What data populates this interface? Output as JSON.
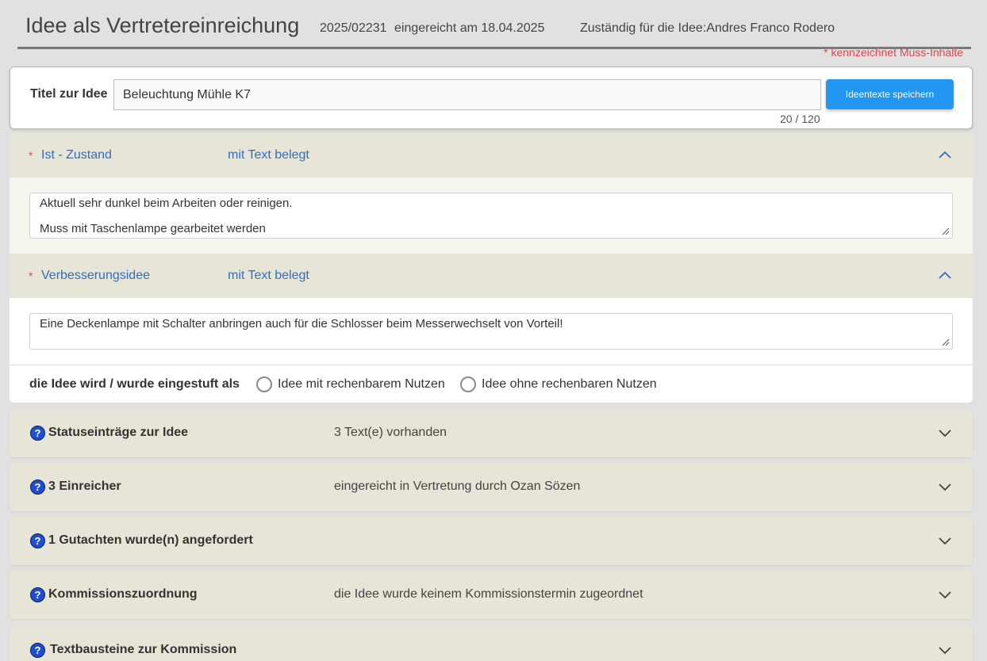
{
  "header": {
    "title": "Idee als Vertretereinreichung",
    "number": "2025/02231",
    "submitted": "eingereicht am 18.04.2025",
    "responsible_label": "Zuständig für die Idee:",
    "responsible_name": "Andres Franco Rodero"
  },
  "required_note": "* kennzeichnet Muss-Inhalte",
  "title_card": {
    "label": "Titel zur Idee",
    "value": "Beleuchtung Mühle K7",
    "counter": "20 / 120",
    "save_label": "Ideentexte speichern"
  },
  "sections": [
    {
      "star": "*",
      "name": "Ist - Zustand",
      "status": "mit Text belegt",
      "text_line1": "Aktuell sehr dunkel beim Arbeiten oder reinigen.",
      "text_line2": "Muss mit Taschenlampe gearbeitet werden"
    },
    {
      "star": "*",
      "name": "Verbesserungsidee",
      "status": "mit Text belegt",
      "text_line1": "Eine Deckenlampe mit Schalter anbringen auch für die Schlosser beim Messerwechselt von Vorteil!"
    }
  ],
  "rating": {
    "label": "die Idee wird / wurde eingestuft als",
    "option1": "Idee mit rechenbarem Nutzen",
    "option2": "Idee ohne rechenbaren Nutzen"
  },
  "accordions": [
    {
      "name": "Statuseinträge zur Idee",
      "info": "3 Text(e) vorhanden"
    },
    {
      "name": "3 Einreicher",
      "info": "eingereicht in Vertretung durch Ozan Sözen"
    },
    {
      "name": "1 Gutachten wurde(n) angefordert",
      "info": ""
    },
    {
      "name": "Kommissionszuordnung",
      "info": "die Idee wurde keinem Kommissionstermin zugeordnet"
    },
    {
      "name": "Textbausteine zur Kommission",
      "info": ""
    }
  ],
  "icons": {
    "help": "help-icon",
    "expand": "chevron-down-icon",
    "collapse": "chevron-up-icon"
  },
  "colors": {
    "accent": "#2196f3",
    "link": "#2f6fbf",
    "required": "#e0464f",
    "section_bg": "#e7e4d8"
  }
}
